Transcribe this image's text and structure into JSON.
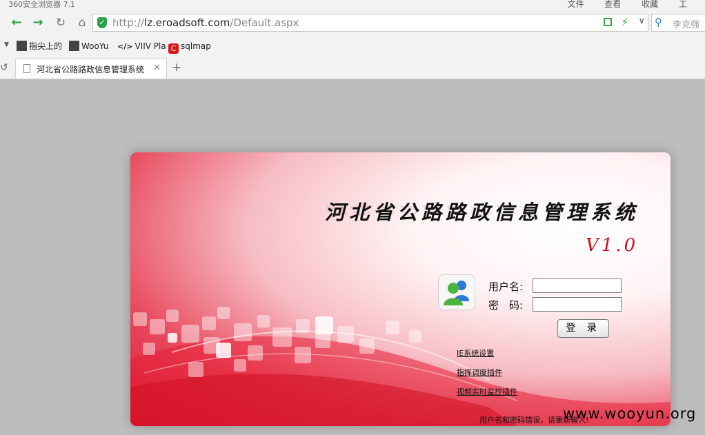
{
  "window": {
    "app_title": "360安全浏览器 7.1",
    "menus": [
      "文件",
      "查看",
      "收藏",
      "工"
    ]
  },
  "toolbar": {
    "url_prefix": "http://",
    "url_host": "lz.eroadsoft.com",
    "url_path": "/Default.aspx",
    "search_placeholder": "李克强",
    "icons": [
      "back-arrow",
      "forward-arrow",
      "reload",
      "home",
      "shield",
      "qr-code",
      "lightning",
      "dropdown",
      "search"
    ]
  },
  "favorites": [
    {
      "label": "指尖上的",
      "icon": "avatar-icon"
    },
    {
      "label": "WooYu",
      "icon": "wooyun-icon"
    },
    {
      "label": "VIIV Pla",
      "icon": "code-icon"
    },
    {
      "label": "sqlmap",
      "icon": "sqlmap-icon"
    }
  ],
  "tabs": [
    {
      "title": "河北省公路路政信息管理系统",
      "active": true
    }
  ],
  "login": {
    "system_title": "河北省公路路政信息管理系统",
    "version": "V1.0",
    "username_label": "用户名:",
    "password_label": "密　码:",
    "username_value": "",
    "password_value": "",
    "login_button": "登 录",
    "links": [
      "IE系统设置",
      "指挥调度插件",
      "视频实时监控插件"
    ],
    "error_message": "用户名和密码错误，请重新输入!"
  },
  "watermark": "www.wooyun.org",
  "colors": {
    "panel_red": "#d9132b",
    "version_red": "#cc0d1f",
    "browser_green": "#2ba245",
    "page_bg": "#bdbdbd"
  }
}
